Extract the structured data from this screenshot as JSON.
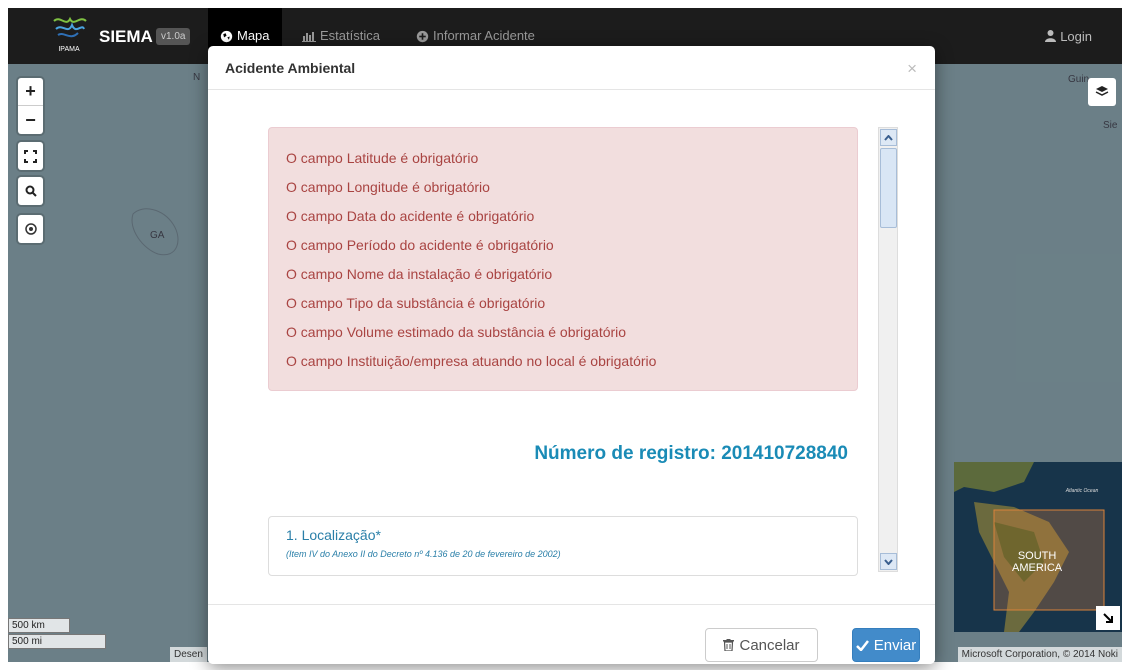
{
  "navbar": {
    "logo_text": "IPAMA",
    "brand": "SIEMA",
    "version": "v1.0a",
    "items": [
      {
        "label": "Mapa",
        "icon": "globe-icon"
      },
      {
        "label": "Estatística",
        "icon": "bar-chart-icon"
      },
      {
        "label": "Informar Acidente",
        "icon": "plus-circle-icon"
      }
    ],
    "login": "Login"
  },
  "map": {
    "labels": {
      "n_partial": "N",
      "ga": "GA",
      "guin_partial": "Guin",
      "sie_partial": "Sie"
    },
    "scale": {
      "km": "500 km",
      "mi": "500 mi"
    },
    "attribution_left": "Desen",
    "attribution_right": "Microsoft Corporation, © 2014 Noki",
    "minimap": {
      "region_label_1": "SOUTH",
      "region_label_2": "AMERICA",
      "ocean_label": "Atlantic Ocean"
    }
  },
  "modal": {
    "title": "Acidente Ambiental",
    "close": "×",
    "errors": [
      "O campo Latitude é obrigatório",
      "O campo Longitude é obrigatório",
      "O campo Data do acidente é obrigatório",
      "O campo Período do acidente é obrigatório",
      "O campo Nome da instalação é obrigatório",
      "O campo Tipo da substância é obrigatório",
      "O campo Volume estimado da substância é obrigatório",
      "O campo Instituição/empresa atuando no local é obrigatório"
    ],
    "registro": "Número de registro: 201410728840",
    "section": {
      "title": "1. Localização*",
      "subtitle": "(Item IV do Anexo II do Decreto nº 4.136 de 20 de fevereiro de 2002)"
    },
    "buttons": {
      "cancel": "Cancelar",
      "send": "Enviar"
    }
  },
  "colors": {
    "navbar": "#1c1c1c",
    "alert_bg": "#f2dede",
    "alert_text": "#a94442",
    "registro": "#1a8bb6",
    "primary": "#428bca"
  }
}
